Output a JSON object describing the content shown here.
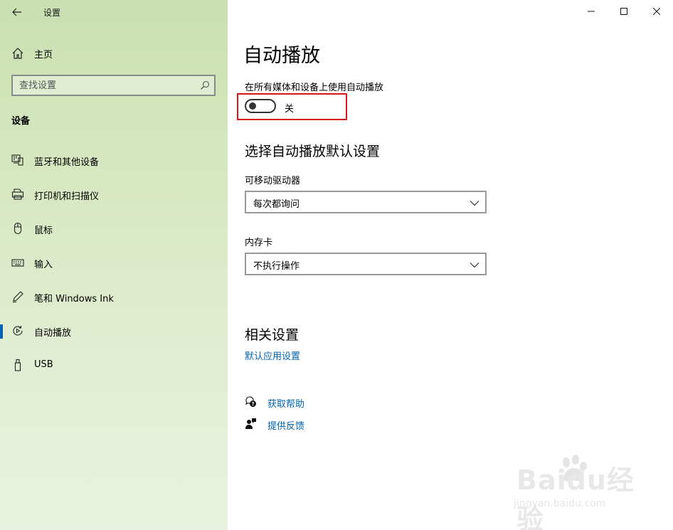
{
  "window": {
    "title": "设置",
    "controls": [
      "minimize",
      "maximize",
      "close"
    ]
  },
  "sidebar": {
    "home_label": "主页",
    "search_placeholder": "查找设置",
    "section_title": "设备",
    "items": [
      {
        "label": "蓝牙和其他设备",
        "icon": "bluetooth-devices-icon"
      },
      {
        "label": "打印机和扫描仪",
        "icon": "printer-icon"
      },
      {
        "label": "鼠标",
        "icon": "mouse-icon"
      },
      {
        "label": "输入",
        "icon": "keyboard-icon"
      },
      {
        "label": "笔和 Windows Ink",
        "icon": "pen-icon"
      },
      {
        "label": "自动播放",
        "icon": "autoplay-icon",
        "active": true
      },
      {
        "label": "USB",
        "icon": "usb-icon"
      }
    ]
  },
  "main": {
    "title": "自动播放",
    "toggle_label": "在所有媒体和设备上使用自动播放",
    "toggle_state": "关",
    "toggle_on": false,
    "defaults_title": "选择自动播放默认设置",
    "removable_label": "可移动驱动器",
    "removable_value": "每次都询问",
    "memory_card_label": "内存卡",
    "memory_card_value": "不执行操作",
    "related_title": "相关设置",
    "related_link": "默认应用设置",
    "help_label": "获取帮助",
    "feedback_label": "提供反馈"
  },
  "watermark": {
    "main": "Baidu经验",
    "sub": "jingyan.baidu.com"
  },
  "colors": {
    "accent": "#0063b1",
    "highlight": "#d9141b",
    "sidebar": "#d8e8c2"
  }
}
